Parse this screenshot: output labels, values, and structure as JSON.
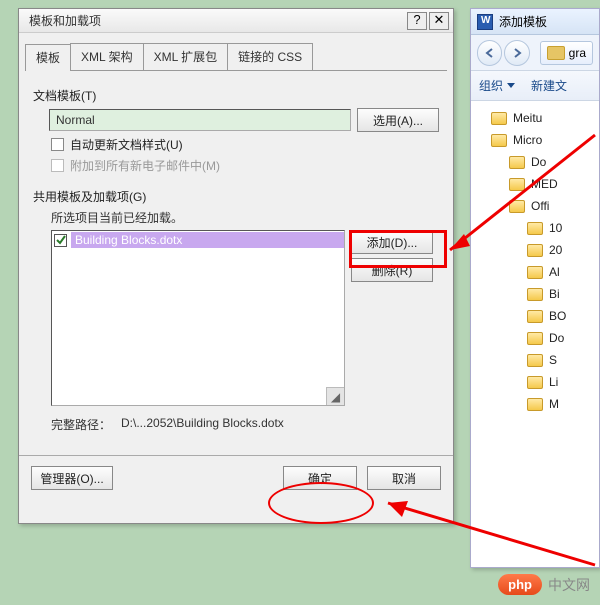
{
  "dialog": {
    "title": "模板和加载项",
    "tabs": [
      "模板",
      "XML 架构",
      "XML 扩展包",
      "链接的 CSS"
    ],
    "doc_template_label": "文档模板(T)",
    "doc_template_value": "Normal",
    "select_btn": "选用(A)...",
    "auto_update": "自动更新文档样式(U)",
    "attach_mail": "附加到所有新电子邮件中(M)",
    "shared_label": "共用模板及加载项(G)",
    "shared_sub": "所选项目当前已经加载。",
    "list_item": "Building Blocks.dotx",
    "add_btn": "添加(D)...",
    "remove_btn": "删除(R)",
    "path_label": "完整路径：",
    "path_value": "D:\\...2052\\Building Blocks.dotx",
    "manager_btn": "管理器(O)...",
    "ok_btn": "确定",
    "cancel_btn": "取消"
  },
  "second": {
    "title": "添加模板",
    "crumb": "gra",
    "organize": "组织",
    "new_folder": "新建文",
    "tree": [
      {
        "label": "Meitu",
        "lvl": 0
      },
      {
        "label": "Micro",
        "lvl": 0
      },
      {
        "label": "Do",
        "lvl": 1
      },
      {
        "label": "MED",
        "lvl": 1
      },
      {
        "label": "Offi",
        "lvl": 1
      },
      {
        "label": "10",
        "lvl": 2
      },
      {
        "label": "20",
        "lvl": 2
      },
      {
        "label": "Al",
        "lvl": 2
      },
      {
        "label": "Bi",
        "lvl": 2
      },
      {
        "label": "BO",
        "lvl": 2
      },
      {
        "label": "Do",
        "lvl": 2
      },
      {
        "label": "S",
        "lvl": 2
      },
      {
        "label": "Li",
        "lvl": 2
      },
      {
        "label": "M",
        "lvl": 2
      }
    ]
  },
  "watermark": {
    "badge": "php",
    "text": "中文网"
  }
}
